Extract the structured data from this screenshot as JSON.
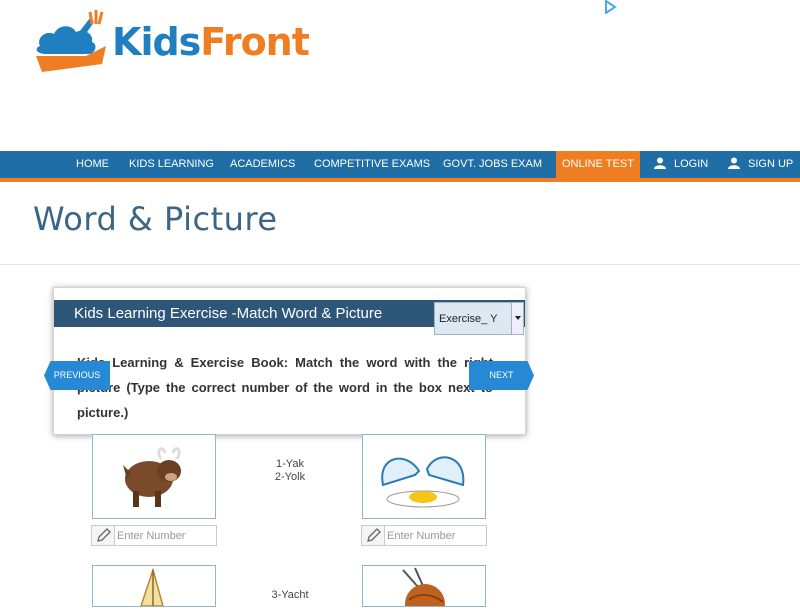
{
  "brand": {
    "part1": "Kids",
    "part2": "Front"
  },
  "nav": {
    "items": [
      "HOME",
      "KIDS LEARNING",
      "ACADEMICS",
      "COMPETITIVE EXAMS",
      "GOVT. JOBS EXAM",
      "ONLINE TEST",
      "LOGIN",
      "SIGN UP"
    ],
    "active": "ONLINE TEST"
  },
  "page": {
    "title": "Word & Picture"
  },
  "exercise": {
    "title": "Kids Learning Exercise -Match Word & Picture",
    "select_value": "Exercise_ Y",
    "description": "Kids Learning & Exercise Book: Match the word with the right picture (Type the correct number of the word in the box next to picture.)",
    "prev_label": "PREVIOUS",
    "next_label": "NEXT"
  },
  "words": {
    "row1_a": "1-Yak",
    "row1_b": "2-Yolk",
    "row2_a": "3-Yacht"
  },
  "input_placeholder": "Enter Number",
  "colors": {
    "nav_bg": "#1f6ea5",
    "accent": "#ef7d22",
    "panel_head": "#2e5679",
    "arrow": "#2689d6"
  }
}
